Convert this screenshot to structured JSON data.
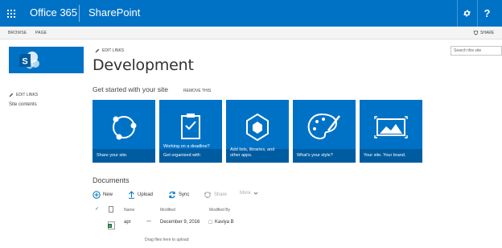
{
  "suite_bar": {
    "brand": "Office 365",
    "app": "SharePoint",
    "settings_label": "⚙",
    "help_label": "?"
  },
  "ribbon": {
    "tabs": [
      "BROWSE",
      "PAGE"
    ],
    "share_label": "SHARE"
  },
  "left_nav": {
    "edit_links": "EDIT LINKS",
    "site_contents": "Site contents"
  },
  "header": {
    "edit_links": "EDIT LINKS",
    "title": "Development",
    "search_placeholder": "Search this site"
  },
  "get_started": {
    "title": "Get started with your site",
    "remove_label": "REMOVE THIS",
    "tiles": [
      {
        "caption": "Share your site.",
        "icon": "share-icon"
      },
      {
        "caption_top": "Working on a deadline?",
        "caption": "Get organized with",
        "icon": "clipboard-icon"
      },
      {
        "caption": "Add lists, libraries, and other apps.",
        "icon": "apps-icon"
      },
      {
        "caption": "What's your style?",
        "icon": "palette-icon"
      },
      {
        "caption": "Your site. Your brand.",
        "icon": "image-icon"
      }
    ]
  },
  "documents": {
    "title": "Documents",
    "commands": {
      "new": "New",
      "upload": "Upload",
      "sync": "Sync",
      "share": "Share",
      "more": "More"
    },
    "columns": {
      "name": "Name",
      "modified": "Modified",
      "modified_by": "Modified By"
    },
    "rows": [
      {
        "name": "apr",
        "ellipsis": "…",
        "modified": "December 9, 2016",
        "modified_by": "Kaviya B"
      }
    ],
    "drag_hint": "Drag files here to upload"
  },
  "colors": {
    "accent": "#0072c6",
    "tile_band": "#004b84"
  }
}
